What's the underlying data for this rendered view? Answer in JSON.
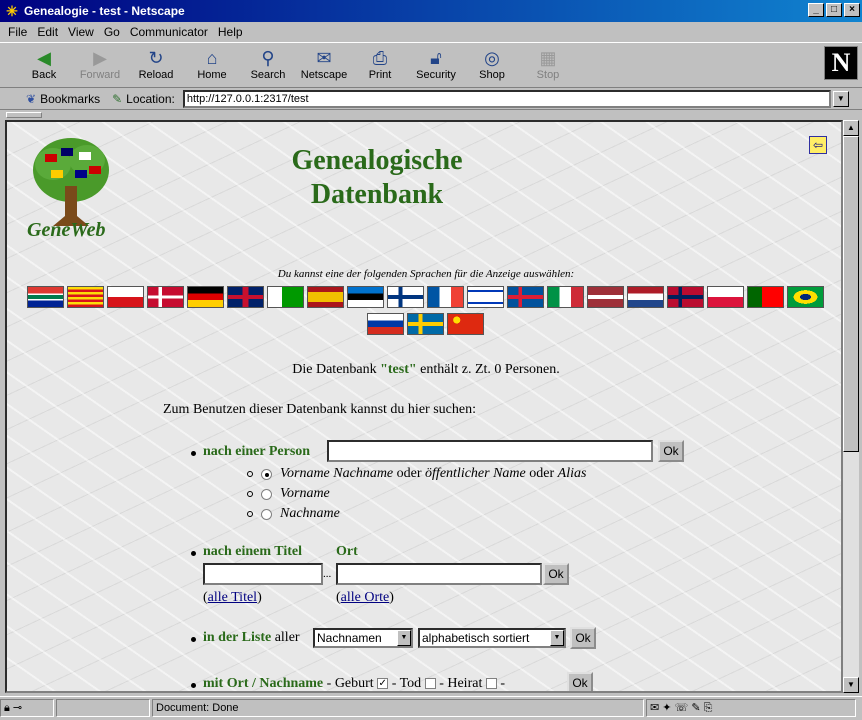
{
  "window": {
    "title": "Genealogie - test - Netscape"
  },
  "menu": [
    "File",
    "Edit",
    "View",
    "Go",
    "Communicator",
    "Help"
  ],
  "toolbar": [
    {
      "label": "Back",
      "icon": "back-arrow-icon",
      "enabled": true
    },
    {
      "label": "Forward",
      "icon": "forward-arrow-icon",
      "enabled": false
    },
    {
      "label": "Reload",
      "icon": "reload-icon",
      "enabled": true
    },
    {
      "label": "Home",
      "icon": "home-icon",
      "enabled": true
    },
    {
      "label": "Search",
      "icon": "search-icon",
      "enabled": true
    },
    {
      "label": "Netscape",
      "icon": "netscape-icon",
      "enabled": true
    },
    {
      "label": "Print",
      "icon": "printer-icon",
      "enabled": true
    },
    {
      "label": "Security",
      "icon": "lock-icon",
      "enabled": true
    },
    {
      "label": "Shop",
      "icon": "shop-icon",
      "enabled": true
    },
    {
      "label": "Stop",
      "icon": "stop-icon",
      "enabled": false
    }
  ],
  "location": {
    "bookmarks_label": "Bookmarks",
    "location_label": "Location:",
    "url": "http://127.0.0.1:2317/test"
  },
  "page": {
    "logo_text": "GeneWeb",
    "title_line1": "Genealogische",
    "title_line2": "Datenbank",
    "lang_prompt": "Du kannst eine der folgenden Sprachen für die Anzeige auswählen:",
    "flags": [
      "za",
      "ca",
      "cz",
      "dk",
      "de",
      "gb",
      "eo",
      "es",
      "ee",
      "fi",
      "fr",
      "il",
      "is",
      "it",
      "lv",
      "nl",
      "no",
      "pl",
      "pt",
      "br",
      "ru",
      "se",
      "cn"
    ],
    "stat_before": "Die Datenbank ",
    "db_name": "\"test\"",
    "stat_after": " enthält z. Zt. 0 Personen.",
    "intro": "Zum Benutzen dieser Datenbank kannst du hier suchen:",
    "person_label": "nach einer Person",
    "ok": "Ok",
    "radio1_a": "Vorname Nachname",
    "radio1_b": " oder ",
    "radio1_c": "öffentlicher Name",
    "radio1_d": " oder ",
    "radio1_e": "Alias",
    "radio2": "Vorname",
    "radio3": "Nachname",
    "title_label": "nach einem Titel",
    "place_label": "Ort",
    "dots": "...",
    "all_titles": "alle Titel",
    "all_places": "alle Orte",
    "list_label": "in der Liste",
    "list_all": " aller ",
    "list_select": "Nachnamen",
    "sort_select": "alphabetisch sortiert",
    "place_name_label": "mit Ort / Nachname",
    "birth": " - Geburt ",
    "death": " - Tod ",
    "marriage": " - Heirat ",
    "dash": " - "
  },
  "status": {
    "text": "Document: Done"
  }
}
